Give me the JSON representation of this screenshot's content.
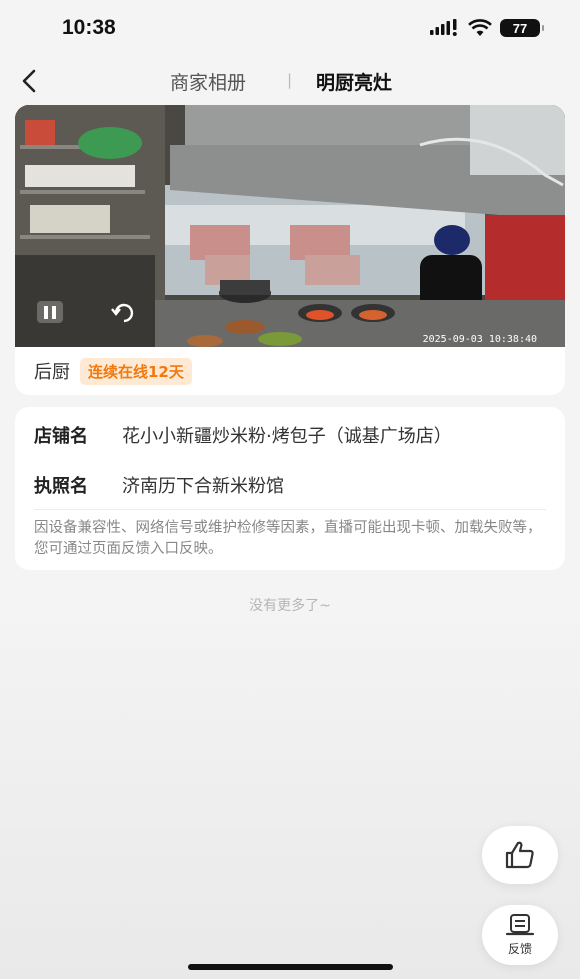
{
  "status_bar": {
    "time": "10:38",
    "battery": "77"
  },
  "nav": {
    "tabs": [
      "商家相册",
      "明厨亮灶"
    ],
    "divider": "|"
  },
  "video": {
    "timestamp": "2025-09-03 10:38:40",
    "caption": "后厨",
    "badge": "连续在线12天"
  },
  "store": {
    "name_label": "店铺名",
    "name_value": "花小小新疆炒米粉·烤包子（诚基广场店）",
    "license_label": "执照名",
    "license_value": "济南历下合新米粉馆",
    "notice": "因设备兼容性、网络信号或维护检修等因素，直播可能出现卡顿、加载失败等，您可通过页面反馈入口反映。"
  },
  "footer": {
    "no_more": "没有更多了~"
  },
  "actions": {
    "feedback_label": "反馈"
  },
  "icons": [
    "back-icon",
    "signal-icon",
    "wifi-icon",
    "battery-icon",
    "pause-icon",
    "rotate-icon",
    "thumbs-up-icon",
    "feedback-icon"
  ]
}
